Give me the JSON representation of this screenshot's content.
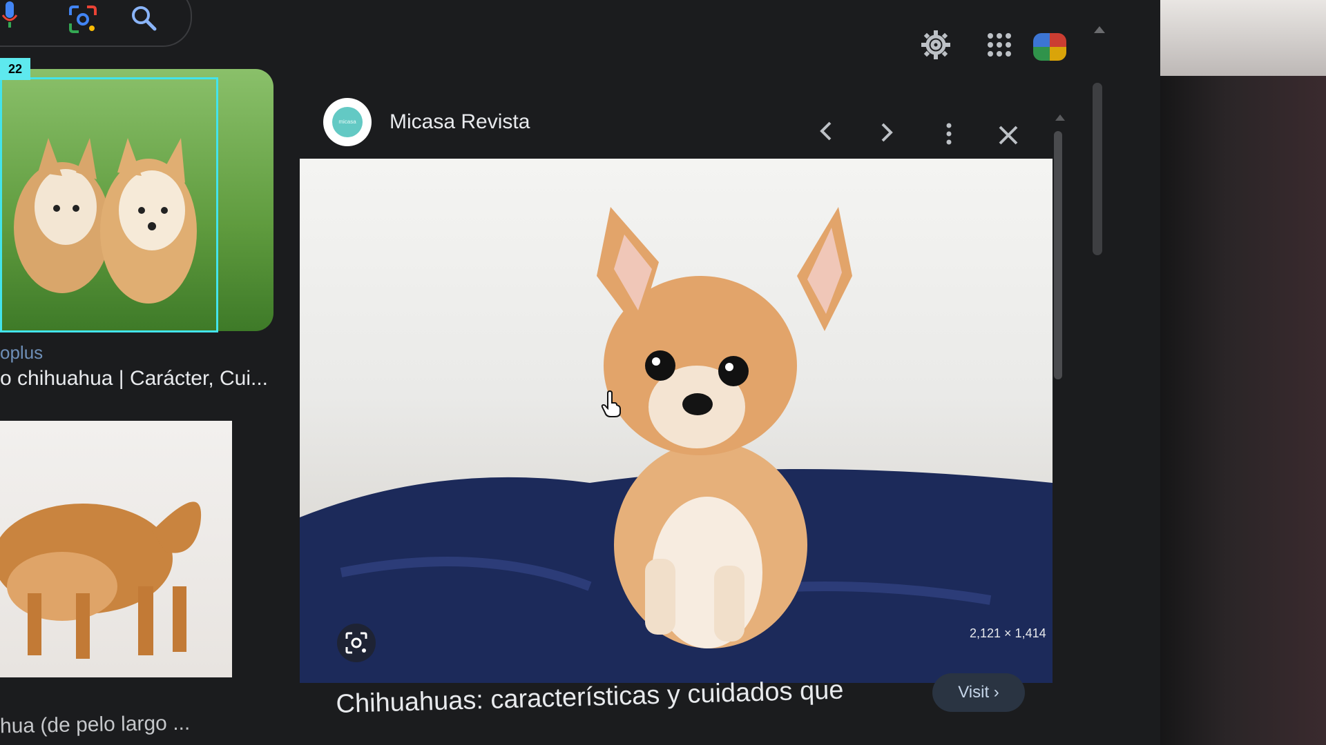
{
  "header": {
    "icons": [
      "mic-icon",
      "lens-icon",
      "search-icon",
      "gear-icon",
      "apps-icon",
      "avatar"
    ]
  },
  "results": [
    {
      "badge": "22",
      "source": "oplus",
      "title": "o chihuahua | Carácter, Cui..."
    },
    {
      "title": "hua (de pelo largo ..."
    }
  ],
  "preview": {
    "site_name": "Micasa Revista",
    "logo_text": "micasa",
    "image_dims": "2,121 × 1,414",
    "visit_label": "Visit",
    "headline": "Chihuahuas: características y cuidados que"
  },
  "colors": {
    "highlight": "#43e4ec",
    "logo": "#63c9c4",
    "background": "#1b1c1e"
  }
}
